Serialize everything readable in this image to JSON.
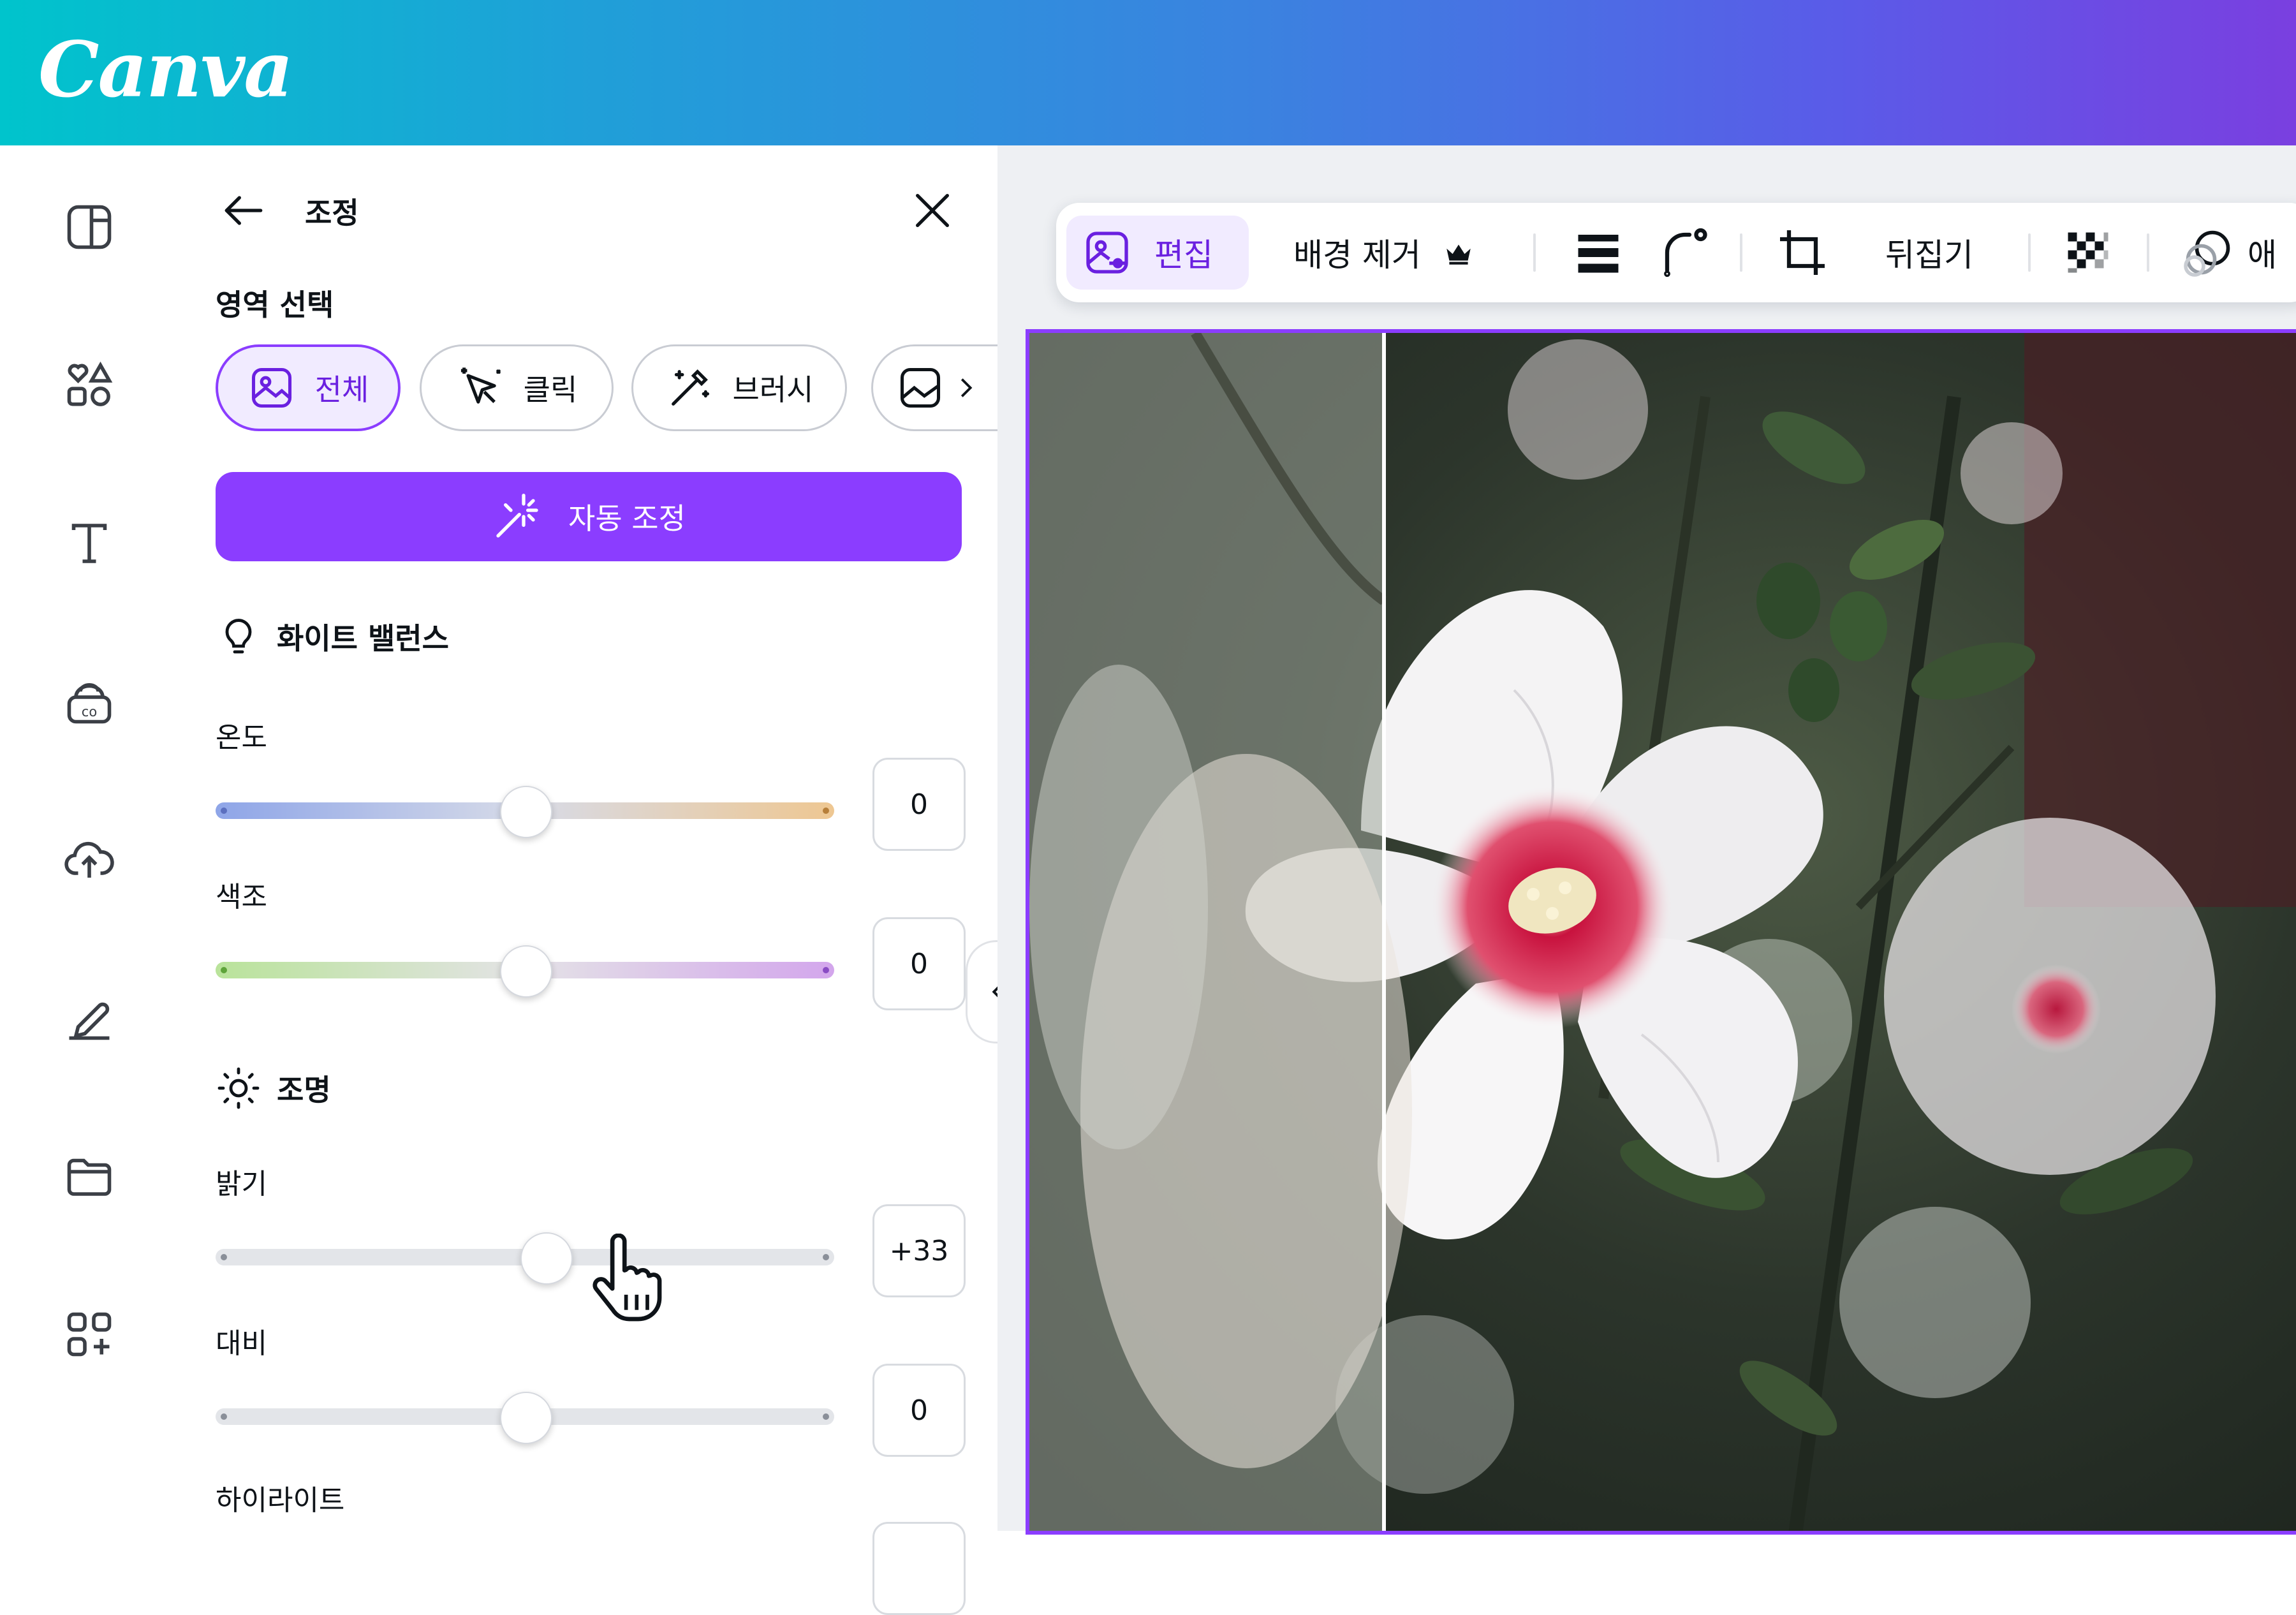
{
  "header": {
    "logo_text": "Canva",
    "gradient_start": "#00c4cc",
    "gradient_end": "#7a3fe0"
  },
  "rail": {
    "items": [
      {
        "icon": "layout-icon"
      },
      {
        "icon": "elements-icon"
      },
      {
        "icon": "text-icon"
      },
      {
        "icon": "brand-icon"
      },
      {
        "icon": "upload-icon"
      },
      {
        "icon": "draw-icon"
      },
      {
        "icon": "projects-icon"
      },
      {
        "icon": "apps-icon"
      }
    ]
  },
  "panel": {
    "title": "조정",
    "region_label": "영역 선택",
    "regions": [
      {
        "label": "전체",
        "active": true
      },
      {
        "label": "클릭",
        "active": false
      },
      {
        "label": "브러시",
        "active": false
      }
    ],
    "auto_adjust_label": "자동 조정",
    "white_balance": {
      "title": "화이트 밸런스",
      "sliders": [
        {
          "label": "온도",
          "value": "0",
          "level": 0
        },
        {
          "label": "색조",
          "value": "0",
          "level": 0
        }
      ]
    },
    "lighting": {
      "title": "조명",
      "sliders": [
        {
          "label": "밝기",
          "value": "+33",
          "level": 33
        },
        {
          "label": "대비",
          "value": "0",
          "level": 0
        },
        {
          "label": "하이라이트",
          "value": "",
          "level": 0
        }
      ]
    }
  },
  "toolbar": {
    "edit_label": "편집",
    "bg_remove_label": "배경 제거",
    "flip_label": "뒤집기",
    "animate_label_partial": "애"
  },
  "colors": {
    "accent": "#8b3dff",
    "accent_light": "#f1ebff"
  }
}
